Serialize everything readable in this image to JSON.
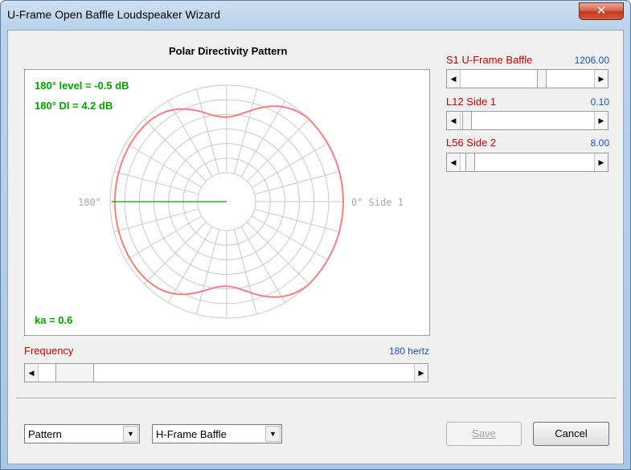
{
  "window": {
    "title": "U-Frame Open Baffle Loudspeaker Wizard",
    "close_glyph": "✕"
  },
  "plot": {
    "heading": "Polar Directivity Pattern",
    "level_text": "180° level = -0.5 dB",
    "di_text": "180° DI = 4.2 dB",
    "ka_text": "ka = 0.6",
    "angle_left": "180°",
    "angle_right": "0° Side 1",
    "curve_color": "#f08080",
    "indicator_color": "#00a000"
  },
  "frequency": {
    "label": "Frequency",
    "value": "180 hertz",
    "position": 0.05
  },
  "sliders": [
    {
      "label": "S1  U-Frame Baffle",
      "value": "1206.00",
      "position": 0.62
    },
    {
      "label": "L12  Side 1",
      "value": "0.10",
      "position": 0.01
    },
    {
      "label": "L56  Side 2",
      "value": "8.00",
      "position": 0.04
    }
  ],
  "controls": {
    "view_select": "Pattern",
    "type_select": "H-Frame Baffle",
    "save_label": "Save",
    "cancel_label": "Cancel",
    "left_arrow": "◀",
    "right_arrow": "▶",
    "drop_arrow": "▼"
  }
}
